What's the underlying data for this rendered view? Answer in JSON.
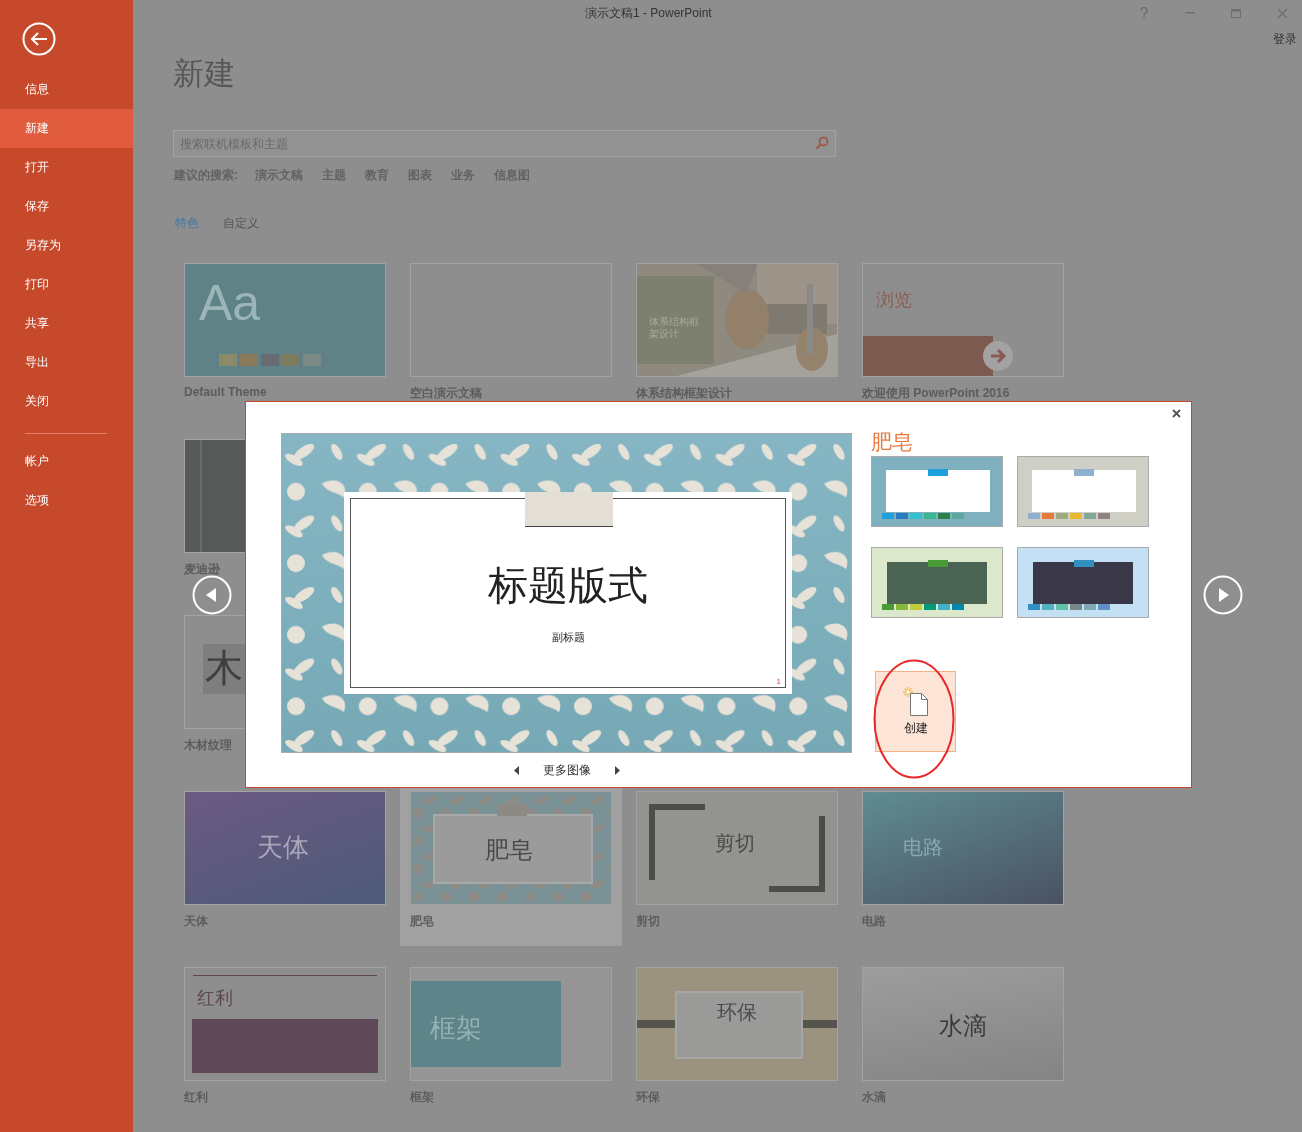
{
  "window": {
    "title": "演示文稿1 - PowerPoint",
    "sign_in": "登录"
  },
  "sidebar": {
    "items": [
      {
        "label": "信息",
        "selected": false
      },
      {
        "label": "新建",
        "selected": true
      },
      {
        "label": "打开",
        "selected": false
      },
      {
        "label": "保存",
        "selected": false
      },
      {
        "label": "另存为",
        "selected": false
      },
      {
        "label": "打印",
        "selected": false
      },
      {
        "label": "共享",
        "selected": false
      },
      {
        "label": "导出",
        "selected": false
      },
      {
        "label": "关闭",
        "selected": false
      }
    ],
    "bottom_items": [
      {
        "label": "帐户",
        "selected": false
      },
      {
        "label": "选项",
        "selected": false
      }
    ]
  },
  "page": {
    "heading": "新建",
    "search": {
      "placeholder": "搜索联机模板和主题"
    },
    "suggested": {
      "label": "建议的搜索:",
      "links": [
        "演示文稿",
        "主题",
        "教育",
        "图表",
        "业务",
        "信息图"
      ]
    },
    "tabs": [
      {
        "label": "特色",
        "selected": true
      },
      {
        "label": "自定义",
        "selected": false
      }
    ]
  },
  "templates": [
    [
      {
        "kind": "aa",
        "thumb_text": "Aa",
        "name": "Default Theme",
        "selected": false
      },
      {
        "kind": "blank",
        "name": "空白演示文稿",
        "selected": false
      },
      {
        "thumb_text": "体系结构框架设计",
        "name": "体系结构框架设计",
        "selected": false
      },
      {
        "kind": "browse",
        "thumb_text": "浏览",
        "name": "欢迎使用 PowerPoint 2016",
        "selected": false
      }
    ],
    [
      {
        "kind": "dark",
        "name": "麦迪逊",
        "selected": false
      }
    ],
    [
      {
        "kind": "wood",
        "thumb_text": "木",
        "name": "木材纹理",
        "selected": false
      }
    ],
    [
      {
        "kind": "celestial",
        "thumb_text": "天体",
        "name": "天体",
        "selected": false
      },
      {
        "kind": "soap",
        "thumb_text": "肥皂",
        "name": "肥皂",
        "selected": true
      },
      {
        "kind": "cut",
        "thumb_text": "剪切",
        "name": "剪切",
        "selected": false
      },
      {
        "kind": "circuit",
        "thumb_text": "电路",
        "name": "电路",
        "selected": false
      }
    ],
    [
      {
        "kind": "dividend",
        "thumb_text": "红利",
        "name": "红利",
        "selected": false
      },
      {
        "kind": "frame",
        "thumb_text": "框架",
        "name": "框架",
        "selected": false
      },
      {
        "kind": "eco",
        "thumb_text": "环保",
        "name": "环保",
        "selected": false
      },
      {
        "kind": "droplet",
        "thumb_text": "水滴",
        "name": "水滴",
        "selected": false
      }
    ]
  ],
  "dialog": {
    "title": "肥皂",
    "slide": {
      "title": "标题版式",
      "subtitle": "副标题",
      "page_number": "1"
    },
    "more_images": "更多图像",
    "variants": [
      {
        "color": "#7fb0c0",
        "kind": "light"
      },
      {
        "color": "#cfcfc5",
        "kind": "light"
      },
      {
        "color": "#dce8cc",
        "kind": "dark"
      },
      {
        "color": "#c4e0f4",
        "kind": "dark"
      }
    ],
    "create_button": "创建"
  }
}
